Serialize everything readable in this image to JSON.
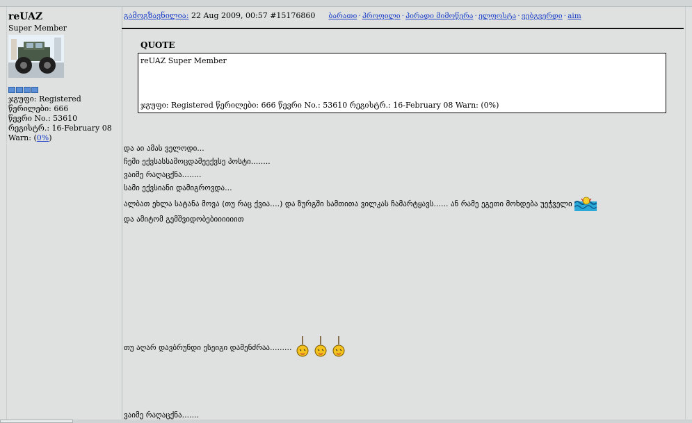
{
  "user": {
    "name": "reUAZ",
    "rank": "Super Member",
    "group": "ჯგუფი: Registered",
    "posts": "წერილები: 666",
    "member_no": "წევრი No.: 53610",
    "registered": "რეგისტრ.: 16-February 08",
    "warn_prefix": "Warn: (",
    "warn_value": "0%",
    "warn_suffix": ")"
  },
  "post": {
    "posted_label": "გამოგზავნილია:",
    "date": "22 Aug 2009, 00:57",
    "post_id": "#15176860",
    "links": [
      "ბარათი",
      "პროფილი",
      "პირადი მიმოწერა",
      "ელფოსტა",
      "ვებგვერდი",
      "aim"
    ]
  },
  "quote": {
    "label": "QUOTE",
    "top_text": "reUAZ Super Member",
    "bottom_text": "ჯგუფი: Registered წერილები: 666 წევრი No.: 53610 რეგისტრ.: 16-February 08 Warn: (0%)"
  },
  "body": {
    "lines": [
      "და აი ამას ველოდი...",
      "ჩემი ექვსასსამოცდამეექვსე პოსტი........",
      "ვაიმე რაღაცქნა........",
      "სამი ექვსიანი დამიგროვდა...",
      "ალბათ ეხლა სატანა მოვა (თუ რაც ქვია....) და ზურგში სამთითა ვილკას ჩამარტყავს...... ან რამე ეგეთი მოხდება უეჭველი",
      "და ამიტომ გემშვიდობებიიიიიით"
    ],
    "line_low1": "თუ აღარ დავბრუნდი ესეიგი დამენძრაა.........",
    "line_low2": "ვაიმე რაღაცქნა......."
  },
  "colors": {
    "background": "#dfe1e1",
    "link": "#1a3ec7",
    "rank_pips": "#5a8fd6"
  },
  "icons": {
    "wave_emote": "drowning-wave-icon",
    "hang_emote": "hanging-smiley-icon"
  }
}
